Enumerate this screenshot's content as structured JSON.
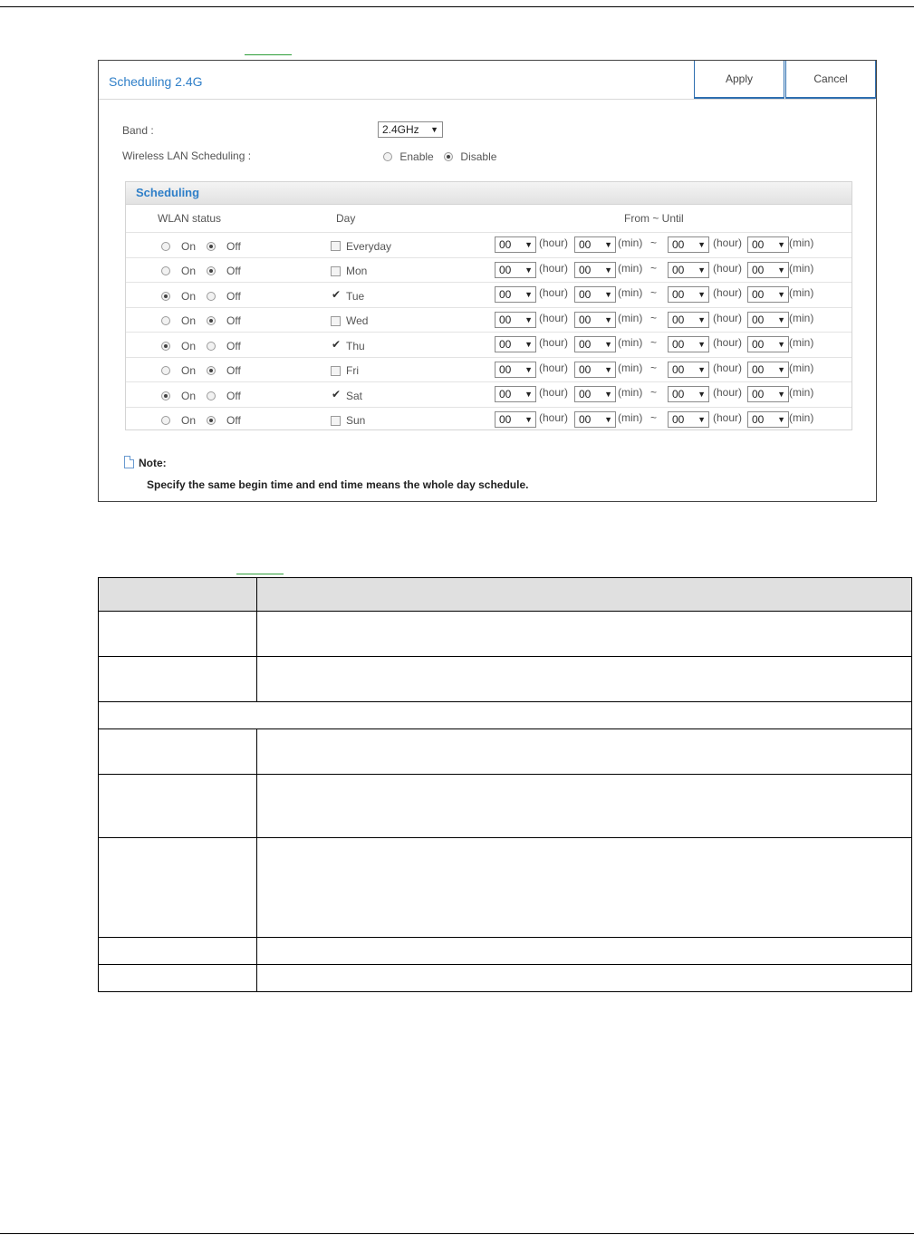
{
  "panel": {
    "title": "Scheduling 2.4G",
    "apply_label": "Apply",
    "cancel_label": "Cancel"
  },
  "band": {
    "label": "Band :",
    "value": "2.4GHz"
  },
  "wlan_scheduling": {
    "label": "Wireless LAN Scheduling :",
    "enable_label": "Enable",
    "disable_label": "Disable",
    "selected": "Disable"
  },
  "scheduling": {
    "title": "Scheduling",
    "col_status": "WLAN status",
    "col_day": "Day",
    "col_time": "From ~ Until",
    "on_label": "On",
    "off_label": "Off",
    "hour_unit": "(hour)",
    "min_unit": "(min)",
    "tilde": "~",
    "rows": [
      {
        "day": "Everyday",
        "status": "Off",
        "checked": false,
        "from_hour": "00",
        "from_min": "00",
        "to_hour": "00",
        "to_min": "00"
      },
      {
        "day": "Mon",
        "status": "Off",
        "checked": false,
        "from_hour": "00",
        "from_min": "00",
        "to_hour": "00",
        "to_min": "00"
      },
      {
        "day": "Tue",
        "status": "On",
        "checked": true,
        "from_hour": "00",
        "from_min": "00",
        "to_hour": "00",
        "to_min": "00"
      },
      {
        "day": "Wed",
        "status": "Off",
        "checked": false,
        "from_hour": "00",
        "from_min": "00",
        "to_hour": "00",
        "to_min": "00"
      },
      {
        "day": "Thu",
        "status": "On",
        "checked": true,
        "from_hour": "00",
        "from_min": "00",
        "to_hour": "00",
        "to_min": "00"
      },
      {
        "day": "Fri",
        "status": "Off",
        "checked": false,
        "from_hour": "00",
        "from_min": "00",
        "to_hour": "00",
        "to_min": "00"
      },
      {
        "day": "Sat",
        "status": "On",
        "checked": true,
        "from_hour": "00",
        "from_min": "00",
        "to_hour": "00",
        "to_min": "00"
      },
      {
        "day": "Sun",
        "status": "Off",
        "checked": false,
        "from_hour": "00",
        "from_min": "00",
        "to_hour": "00",
        "to_min": "00"
      }
    ]
  },
  "note": {
    "title": "Note:",
    "text": "Specify the same begin time and end time means the whole day schedule."
  }
}
